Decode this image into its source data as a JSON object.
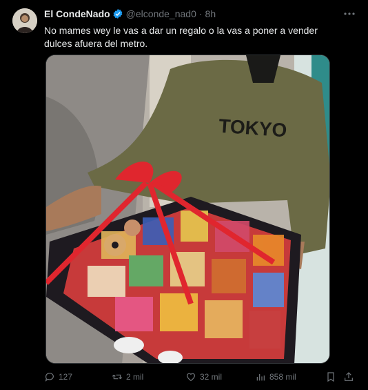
{
  "author": {
    "name": "El CondeNado",
    "handle": "@elconde_nad0",
    "separator": "·",
    "time": "8h",
    "avatar_icon": "avatar-icon",
    "verified_icon": "verified-badge-icon",
    "verified_color": "#1d9bf0"
  },
  "tweet": {
    "text": "No mames wey le vas a dar un regalo o la vas a poner a vender dulces afuera del metro."
  },
  "media": {
    "shirt_text": "TOKYO"
  },
  "actions": {
    "replies": "127",
    "retweets": "2 mil",
    "likes": "32 mil",
    "views": "858 mil"
  },
  "colors": {
    "background": "#000000",
    "text": "#e7e9ea",
    "muted": "#71767b",
    "accent": "#1d9bf0"
  }
}
